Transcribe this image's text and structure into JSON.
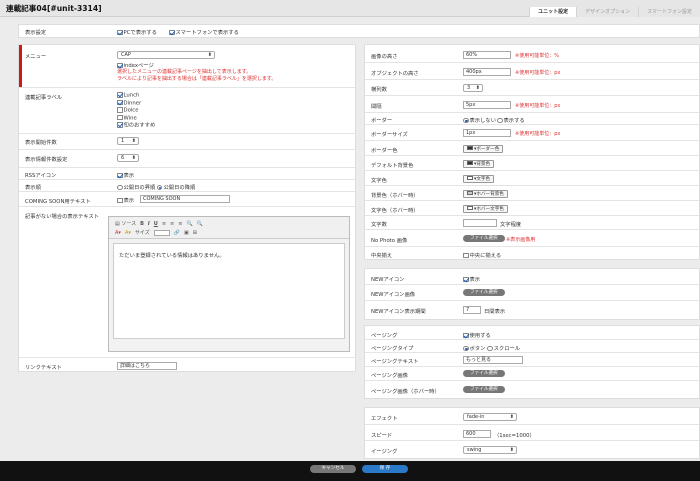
{
  "title": "連載記事04[#unit-3314]",
  "tabs": [
    "ユニット設定",
    "デザインオプション",
    "スマートフォン設定"
  ],
  "display": {
    "label": "表示設定",
    "pc": "PCで表示する",
    "sp": "スマートフォンで表示する"
  },
  "left": {
    "menu_label": "メニュー",
    "menu_value": "CAP",
    "index_page": "indexページ",
    "menu_note1": "選択したメニューの連載記事ページを抽出して表示します。",
    "menu_note2": "ラベルにより記事を抽出する場合は「連載記事ラベル」を選択します。",
    "series_label": "連載記事ラベル",
    "labels": [
      "Lunch",
      "Dinner",
      "Dolce",
      "Wine",
      "旬のおすすめ"
    ],
    "start_label": "表示開始件数",
    "start_value": "1",
    "count_label": "表示情報件数設定",
    "count_value": "6",
    "rss_label": "RSSアイコン",
    "rss_text": "表示",
    "order_label": "表示順",
    "order_opt1": "公開日の昇順",
    "order_opt2": "公開日の降順",
    "soon_label": "COMING SOON用テキスト",
    "soon_check": "表示",
    "soon_value": "COMING SOON",
    "empty_label": "記事がない場合の表示テキスト",
    "editor_source": "ソース",
    "editor_size": "サイズ",
    "editor_text": "ただいま登録されている情報はありません。",
    "link_label": "リンクテキスト",
    "link_value": "詳細はこちら"
  },
  "right": {
    "img_h_label": "画像の高さ",
    "img_h_value": "60%",
    "img_h_note": "※使用可能単位：%",
    "obj_h_label": "オブジェクトの高さ",
    "obj_h_value": "400px",
    "obj_h_note": "※使用可能単位：px",
    "cols_label": "横列数",
    "cols_value": "3",
    "gap_label": "間隔",
    "gap_value": "5px",
    "gap_note": "※使用可能単位：px",
    "border_label": "ボーダー",
    "border_opt1": "表示しない",
    "border_opt2": "表示する",
    "bsize_label": "ボーダーサイズ",
    "bsize_value": "1px",
    "bsize_note": "※使用可能単位：px",
    "bcolor_label": "ボーダー色",
    "bcolor_btn": "ボーダー色",
    "bg_label": "デフォルト背景色",
    "bg_btn": "背景色",
    "tcolor_label": "文字色",
    "tcolor_btn": "文字色",
    "hbg_label": "背景色（ホバー時）",
    "hbg_btn": "ホバー背景色",
    "htc_label": "文字色（ホバー時）",
    "htc_btn": "ホバー文字色",
    "chars_label": "文字数",
    "chars_unit": "文字程度",
    "nophoto_label": "No Photo 画像",
    "file_btn": "ファイル選択",
    "nophoto_note": "※表示画像用",
    "center_label": "中央揃え",
    "center_text": "中央に揃える",
    "new_label": "NEWアイコン",
    "new_text": "表示",
    "newimg_label": "NEWアイコン画像",
    "newdays_label": "NEWアイコン表示期間",
    "newdays_value": "7",
    "newdays_unit": "日間表示",
    "paging_label": "ページング",
    "paging_text": "使用する",
    "ptype_label": "ページングタイプ",
    "ptype_opt1": "ボタン",
    "ptype_opt2": "スクロール",
    "ptext_label": "ページングテキスト",
    "ptext_value": "もっと見る",
    "pimg_label": "ページング画像",
    "pimgh_label": "ページング画像（ホバー時）",
    "effect_label": "エフェクト",
    "effect_value": "fade-in",
    "speed_label": "スピード",
    "speed_value": "600",
    "speed_unit": "（1sec=1000）",
    "easing_label": "イージング",
    "easing_value": "swing"
  },
  "footer": {
    "cancel": "キャンセル",
    "save": "保 存"
  },
  "colors": {
    "accent_red": "#cc1a1a",
    "save_blue": "#2a78c8"
  }
}
